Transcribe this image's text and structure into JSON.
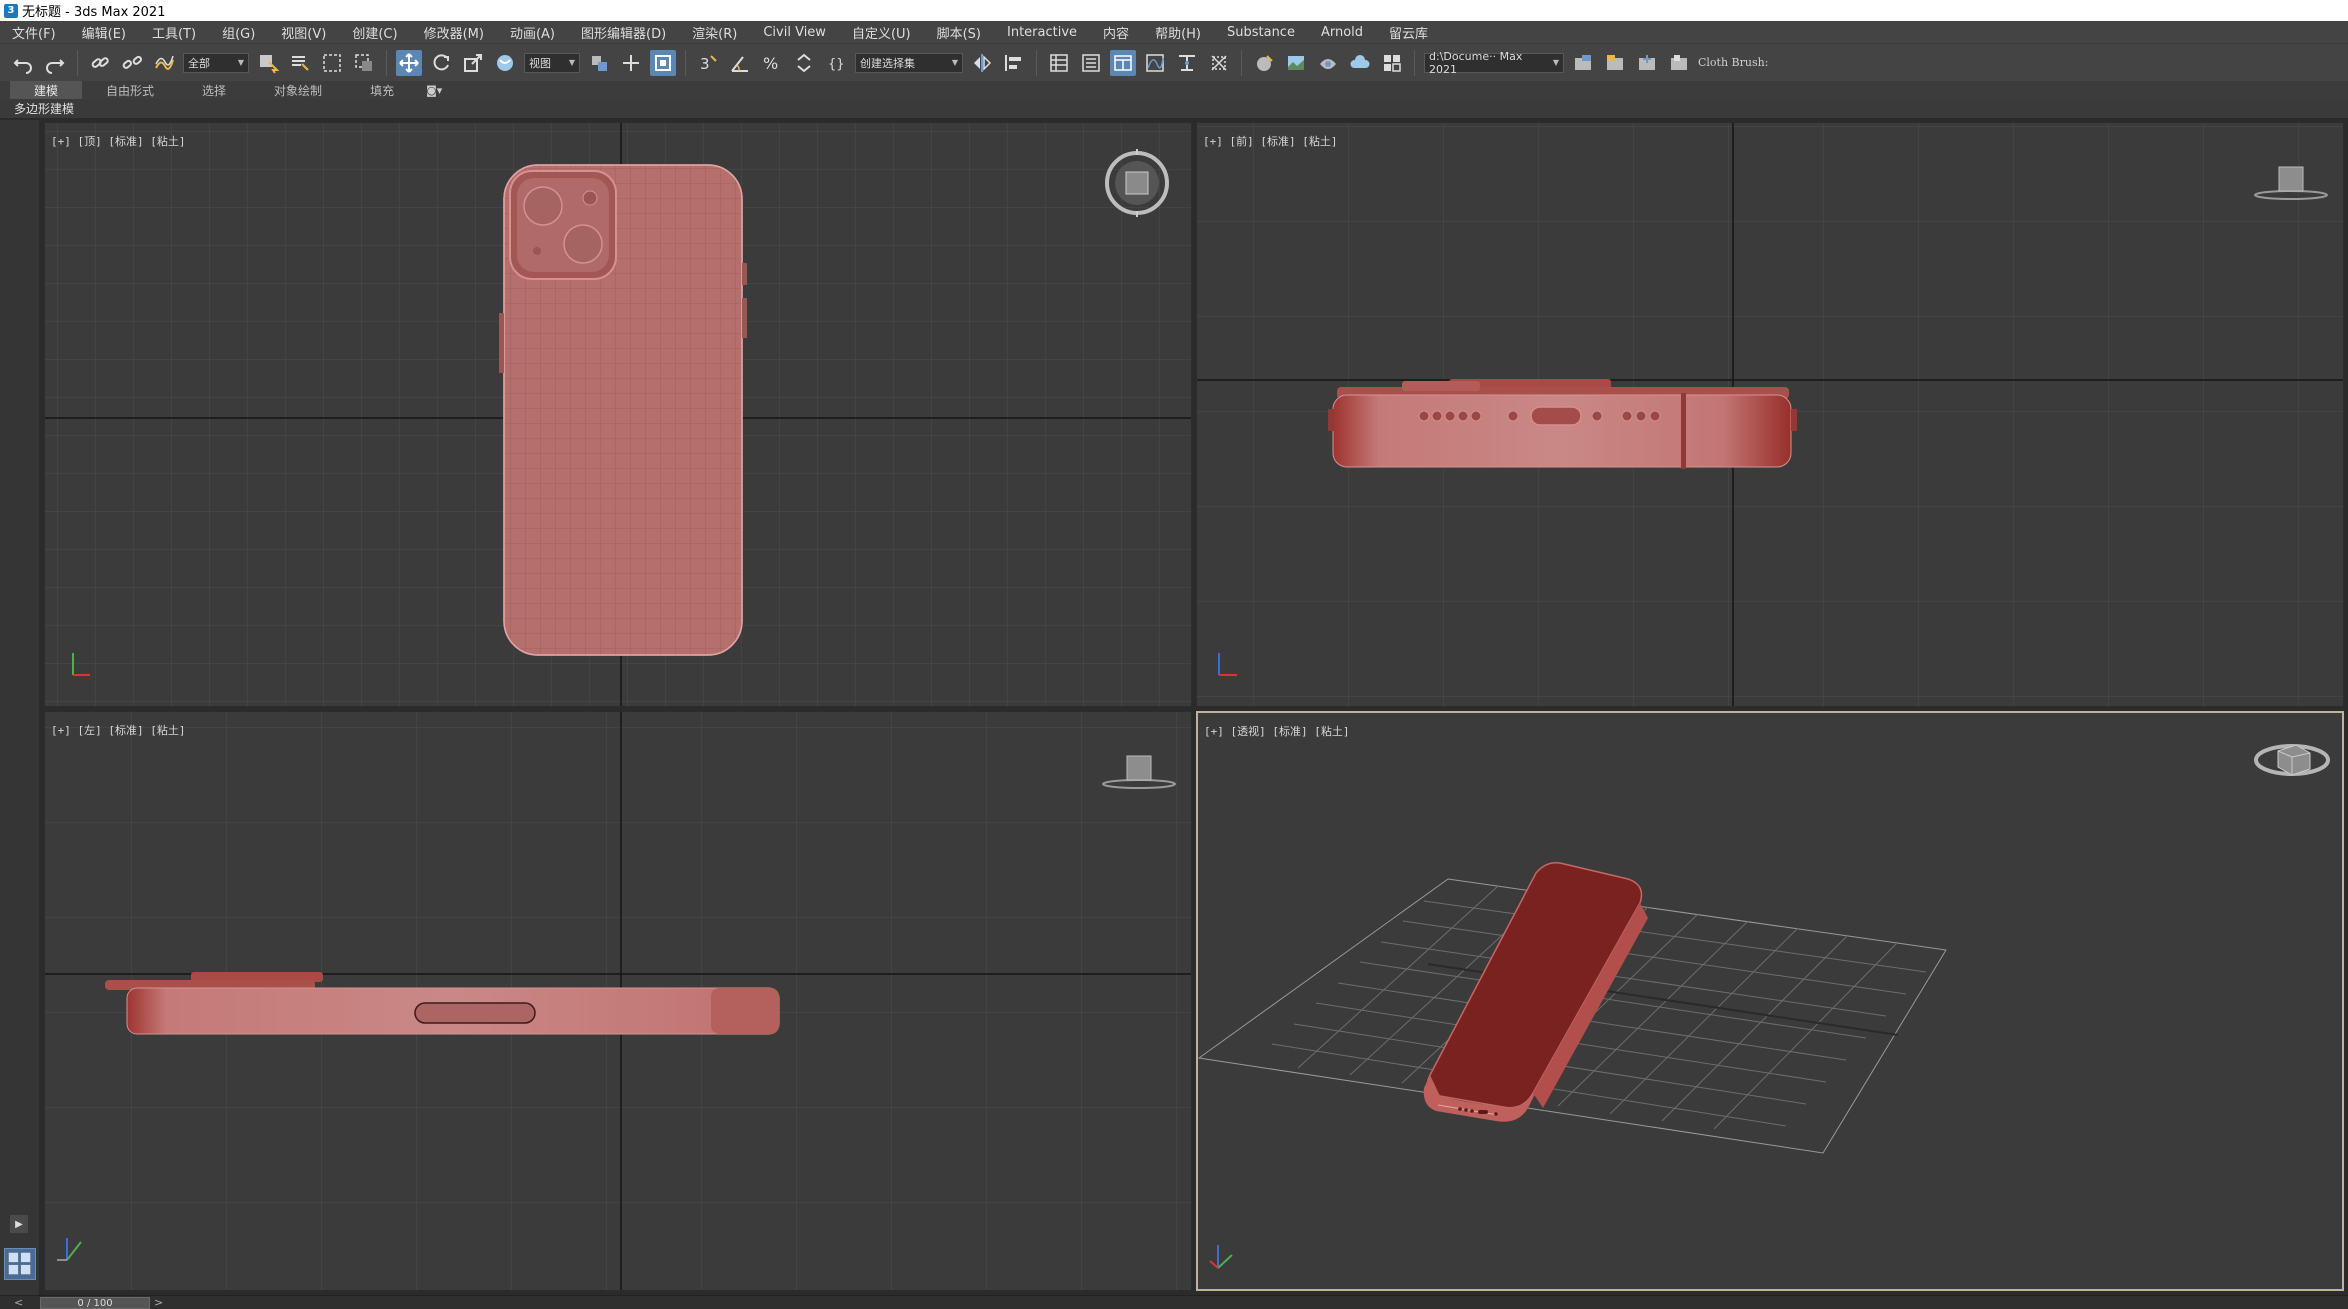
{
  "window": {
    "title": "无标题 - 3ds Max 2021",
    "app_icon": "3"
  },
  "menubar": {
    "items": [
      "文件(F)",
      "编辑(E)",
      "工具(T)",
      "组(G)",
      "视图(V)",
      "创建(C)",
      "修改器(M)",
      "动画(A)",
      "图形编辑器(D)",
      "渲染(R)",
      "Civil View",
      "自定义(U)",
      "脚本(S)",
      "Interactive",
      "内容",
      "帮助(H)",
      "Substance",
      "Arnold",
      "留云库"
    ]
  },
  "toolbar": {
    "selection_filter": "全部",
    "reference_coord": "视图",
    "named_selection": "创建选择集",
    "project_path": "d:\\Docume·· Max 2021",
    "brush_label": "Cloth Brush:"
  },
  "ribbon": {
    "tabs": [
      "建模",
      "自由形式",
      "选择",
      "对象绘制",
      "填充"
    ],
    "active_tab": "建模",
    "sub_label": "多边形建模"
  },
  "viewports": {
    "top": {
      "label": "[+] [顶] [标准] [粘土]"
    },
    "front": {
      "label": "[+] [前] [标准] [粘土]"
    },
    "left": {
      "label": "[+] [左] [标准] [粘土]"
    },
    "perspective": {
      "label": "[+] [透视] [标准] [粘土]"
    }
  },
  "timeline": {
    "frame_display": "0 / 100",
    "prev": "<",
    "next": ">"
  },
  "colors": {
    "clay_body": "#b5706e",
    "clay_dark": "#7a2220",
    "viewport_bg": "#3b3b3b",
    "grid_line": "#4c4c4c",
    "active_border": "#bdb59a"
  },
  "icons": [
    "undo-icon",
    "redo-icon",
    "link-icon",
    "unlink-icon",
    "bind-spacewarp-icon",
    "select-object-icon",
    "select-by-name-icon",
    "rect-selection-icon",
    "window-crossing-icon",
    "move-icon",
    "rotate-icon",
    "scale-icon",
    "placement-icon",
    "pivot-icon",
    "snap-icon",
    "angle-snap-icon",
    "percent-snap-icon",
    "spinner-snap-icon",
    "edit-named-selection-icon",
    "mirror-icon",
    "align-icon",
    "scene-explorer-icon",
    "layer-explorer-icon",
    "ribbon-toggle-icon",
    "curve-editor-icon",
    "schematic-view-icon",
    "material-editor-icon",
    "render-setup-icon",
    "rendered-frame-icon",
    "render-icon",
    "render-cloud-icon",
    "arnold-icon"
  ]
}
